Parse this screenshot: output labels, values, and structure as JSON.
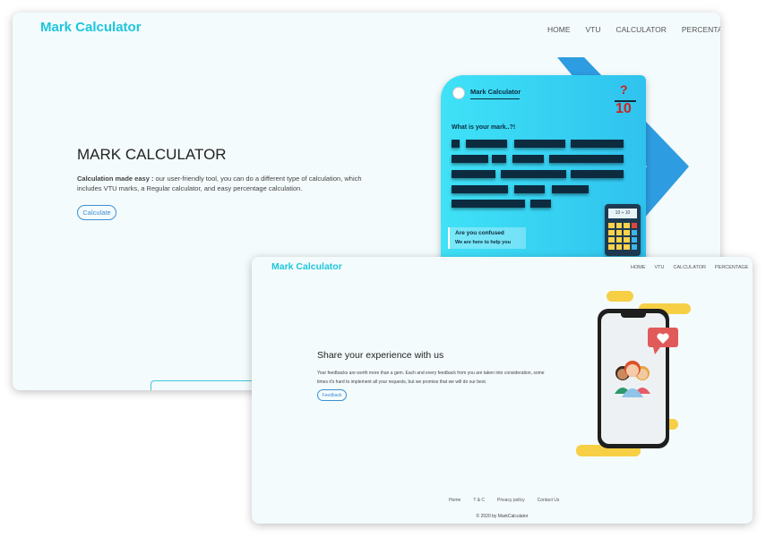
{
  "back": {
    "logo": "Mark Calculator",
    "nav": [
      "HOME",
      "VTU",
      "CALCULATOR",
      "PERCENTAGE"
    ],
    "hero_title": "MARK CALCULATOR",
    "hero_bold": "Calculation made easy :",
    "hero_text": " our user-friendly tool, you can do a different type of calculation, which includes VTU marks, a Regular calculator, and easy percentage calculation.",
    "calculate_label": "Calculate",
    "illustration": {
      "title": "Mark Calculator",
      "question_mark": "?",
      "denominator": "10",
      "question": "What is your mark..?!",
      "confused": "Are you confused",
      "help": "We are here to help you",
      "calc_display": "10 ÷ 10"
    }
  },
  "front": {
    "logo": "Mark Calculator",
    "nav": [
      "HOME",
      "VTU",
      "CALCULATOR",
      "PERCENTAGE"
    ],
    "heading": "Share your experience with us",
    "text": "Your feedbacks are worth more than a gem. Each and every feedback from you are taken into consideration, some times it's hard to implement all your requests, but we promise that we will do our best.",
    "feedback_label": "Feedback",
    "footer_links": [
      "Home",
      "T & C",
      "Privacy policy",
      "Contact Us"
    ],
    "copyright": "© 2020 by MarkCalculator"
  },
  "colors": {
    "brand": "#1ec6dd",
    "accent": "#3b8fd6",
    "heart": "#e05a5a",
    "yellow": "#f6cf45"
  }
}
